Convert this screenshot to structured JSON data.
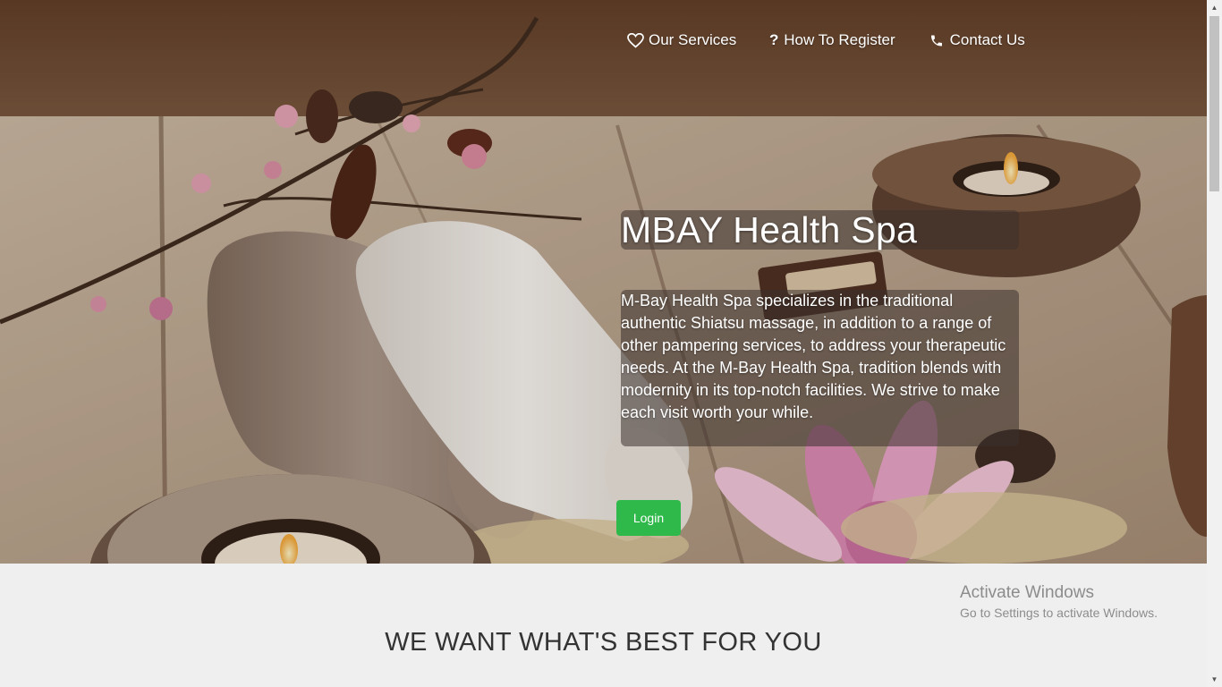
{
  "nav": {
    "items": [
      {
        "label": "Our Services",
        "icon": "heart-icon"
      },
      {
        "label": "How To Register",
        "icon": "question-icon"
      },
      {
        "label": "Contact Us",
        "icon": "phone-icon"
      }
    ]
  },
  "hero": {
    "title": "MBAY Health Spa",
    "description": "M-Bay Health Spa specializes in the traditional authentic Shiatsu massage, in addition to a range of other pampering services, to address your therapeutic needs. At the M-Bay Health Spa, tradition blends with modernity in its top-notch facilities. We strive to make each visit worth your while.",
    "login_label": "Login",
    "background_image": "spa towels, candles and flowers on wooden table"
  },
  "section": {
    "heading": "WE WANT WHAT'S BEST FOR YOU"
  },
  "watermark": {
    "title": "Activate Windows",
    "subtitle": "Go to Settings to activate Windows."
  },
  "colors": {
    "accent_green": "#2fb94a",
    "overlay": "rgba(60,50,45,0.55)",
    "page_bg": "#efefef"
  }
}
